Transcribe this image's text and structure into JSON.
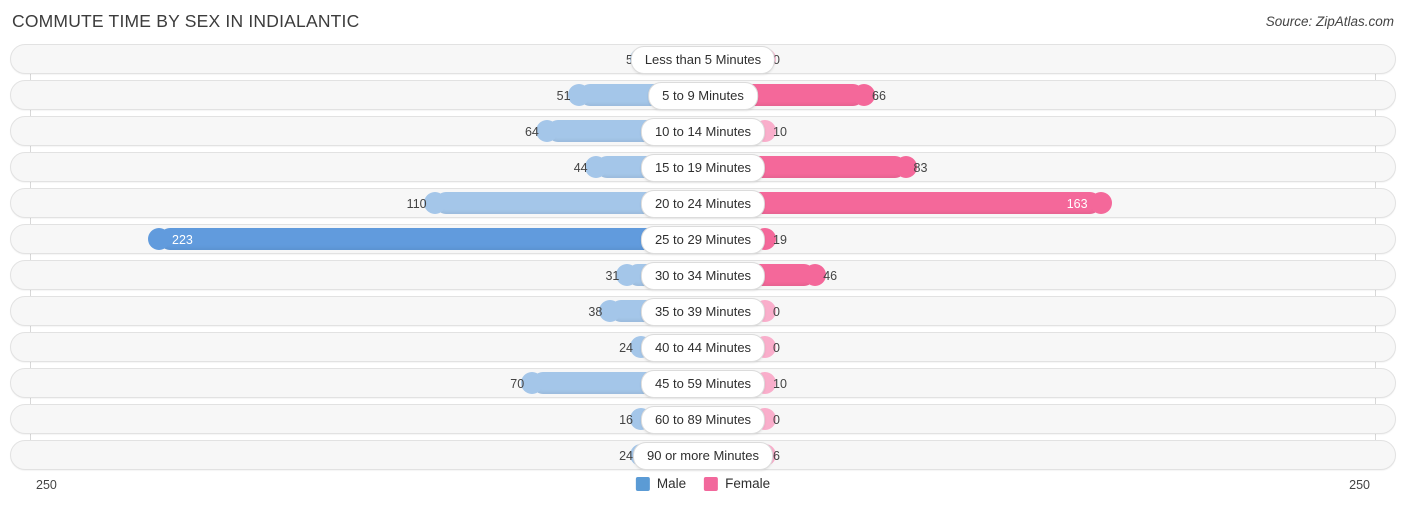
{
  "header": {
    "title": "COMMUTE TIME BY SEX IN INDIALANTIC",
    "source": "Source: ZipAtlas.com"
  },
  "legend": {
    "male_label": "Male",
    "female_label": "Female",
    "male_color": "#5b9bd5",
    "female_color": "#f2689c"
  },
  "axis": {
    "left_max": "250",
    "right_max": "250",
    "max_value": 250
  },
  "chart_data": {
    "type": "bar",
    "title": "COMMUTE TIME BY SEX IN INDIALANTIC",
    "orientation": "horizontal-diverging",
    "xlabel": "",
    "ylabel": "",
    "xlim": [
      250,
      250
    ],
    "grid": false,
    "legend_position": "bottom-center",
    "categories": [
      "Less than 5 Minutes",
      "5 to 9 Minutes",
      "10 to 14 Minutes",
      "15 to 19 Minutes",
      "20 to 24 Minutes",
      "25 to 29 Minutes",
      "30 to 34 Minutes",
      "35 to 39 Minutes",
      "40 to 44 Minutes",
      "45 to 59 Minutes",
      "60 to 89 Minutes",
      "90 or more Minutes"
    ],
    "series": [
      {
        "name": "Male",
        "values": [
          5,
          51,
          64,
          44,
          110,
          223,
          31,
          38,
          24,
          70,
          16,
          24
        ]
      },
      {
        "name": "Female",
        "values": [
          0,
          66,
          10,
          83,
          163,
          19,
          46,
          0,
          0,
          10,
          0,
          6
        ]
      }
    ]
  },
  "rows": [
    {
      "label": "Less than 5 Minutes",
      "male": "5",
      "female": "0",
      "male_v": 5,
      "female_v": 0,
      "male_hi": false,
      "female_hi": false,
      "male_inside": false,
      "female_inside": false
    },
    {
      "label": "5 to 9 Minutes",
      "male": "51",
      "female": "66",
      "male_v": 51,
      "female_v": 66,
      "male_hi": false,
      "female_hi": true,
      "male_inside": false,
      "female_inside": false
    },
    {
      "label": "10 to 14 Minutes",
      "male": "64",
      "female": "10",
      "male_v": 64,
      "female_v": 10,
      "male_hi": false,
      "female_hi": false,
      "male_inside": false,
      "female_inside": false
    },
    {
      "label": "15 to 19 Minutes",
      "male": "44",
      "female": "83",
      "male_v": 44,
      "female_v": 83,
      "male_hi": false,
      "female_hi": true,
      "male_inside": false,
      "female_inside": false
    },
    {
      "label": "20 to 24 Minutes",
      "male": "110",
      "female": "163",
      "male_v": 110,
      "female_v": 163,
      "male_hi": false,
      "female_hi": true,
      "male_inside": false,
      "female_inside": true
    },
    {
      "label": "25 to 29 Minutes",
      "male": "223",
      "female": "19",
      "male_v": 223,
      "female_v": 19,
      "male_hi": true,
      "female_hi": true,
      "male_inside": true,
      "female_inside": false
    },
    {
      "label": "30 to 34 Minutes",
      "male": "31",
      "female": "46",
      "male_v": 31,
      "female_v": 46,
      "male_hi": false,
      "female_hi": true,
      "male_inside": false,
      "female_inside": false
    },
    {
      "label": "35 to 39 Minutes",
      "male": "38",
      "female": "0",
      "male_v": 38,
      "female_v": 0,
      "male_hi": false,
      "female_hi": false,
      "male_inside": false,
      "female_inside": false
    },
    {
      "label": "40 to 44 Minutes",
      "male": "24",
      "female": "0",
      "male_v": 24,
      "female_v": 0,
      "male_hi": false,
      "female_hi": false,
      "male_inside": false,
      "female_inside": false
    },
    {
      "label": "45 to 59 Minutes",
      "male": "70",
      "female": "10",
      "male_v": 70,
      "female_v": 10,
      "male_hi": false,
      "female_hi": false,
      "male_inside": false,
      "female_inside": false
    },
    {
      "label": "60 to 89 Minutes",
      "male": "16",
      "female": "0",
      "male_v": 16,
      "female_v": 0,
      "male_hi": false,
      "female_hi": false,
      "male_inside": false,
      "female_inside": false
    },
    {
      "label": "90 or more Minutes",
      "male": "24",
      "female": "6",
      "male_v": 24,
      "female_v": 6,
      "male_hi": false,
      "female_hi": false,
      "male_inside": false,
      "female_inside": false
    }
  ]
}
